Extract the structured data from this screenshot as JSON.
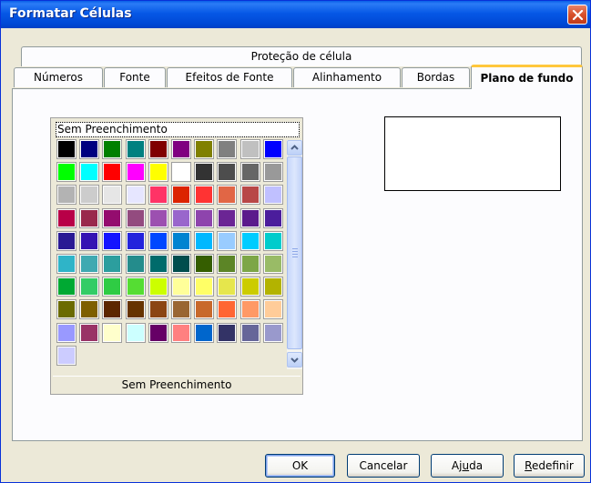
{
  "window": {
    "title": "Formatar Células"
  },
  "tabs": {
    "row_back": [
      {
        "label": "Proteção de célula"
      }
    ],
    "row_front": [
      {
        "label": "Números"
      },
      {
        "label": "Fonte"
      },
      {
        "label": "Efeitos de Fonte"
      },
      {
        "label": "Alinhamento"
      },
      {
        "label": "Bordas"
      },
      {
        "label": "Plano de fundo",
        "active": true
      }
    ]
  },
  "background_panel": {
    "no_fill_top": "Sem Preenchimento",
    "no_fill_bottom": "Sem Preenchimento",
    "palette": [
      "#000000",
      "#000080",
      "#008000",
      "#008080",
      "#800000",
      "#800080",
      "#808000",
      "#808080",
      "#c0c0c0",
      "#0000ff",
      "#00ff00",
      "#00ffff",
      "#ff0000",
      "#ff00ff",
      "#ffff00",
      "#ffffff",
      "#333333",
      "#4d4d4d",
      "#666666",
      "#999999",
      "#b3b3b3",
      "#cccccc",
      "#e6e6e6",
      "#e6e6ff",
      "#ff3366",
      "#dc2300",
      "#ff3333",
      "#e16645",
      "#b84747",
      "#c0c0ff",
      "#b80047",
      "#99284c",
      "#940c6e",
      "#934b7f",
      "#9c50b0",
      "#9966cc",
      "#8e44ad",
      "#6b2594",
      "#5b1b8c",
      "#4b1d9c",
      "#2a1a94",
      "#3413b3",
      "#1414ff",
      "#2323dc",
      "#0047ff",
      "#0084d1",
      "#00b8ff",
      "#99ccff",
      "#00ccff",
      "#00cccc",
      "#2fb4c8",
      "#3fa9b1",
      "#2c9e9e",
      "#248c8c",
      "#006b6b",
      "#004d4d",
      "#355e00",
      "#5c8526",
      "#7da647",
      "#99bb66",
      "#00a933",
      "#33cc66",
      "#2fcc44",
      "#55dd33",
      "#ccff00",
      "#ffff99",
      "#ffff66",
      "#e6e64c",
      "#cccc00",
      "#b3b300",
      "#6b6b00",
      "#7e5f00",
      "#5c2600",
      "#663300",
      "#8b4513",
      "#996633",
      "#c8692b",
      "#ff6633",
      "#ff9966",
      "#ffcc99",
      "#9999ff",
      "#993366",
      "#ffffcc",
      "#ccffff",
      "#660066",
      "#ff8080",
      "#0066cc",
      "#333366",
      "#666699",
      "#9999cc",
      "#ccccff"
    ]
  },
  "buttons": {
    "ok": "OK",
    "cancel": "Cancelar",
    "help_prefix": "Aj",
    "help_mnemonic": "u",
    "help_suffix": "da",
    "reset_mnemonic": "R",
    "reset_suffix": "edefinir"
  },
  "icons": {
    "close": "close-icon",
    "scroll_up": "chevron-up-icon",
    "scroll_down": "chevron-down-icon"
  }
}
